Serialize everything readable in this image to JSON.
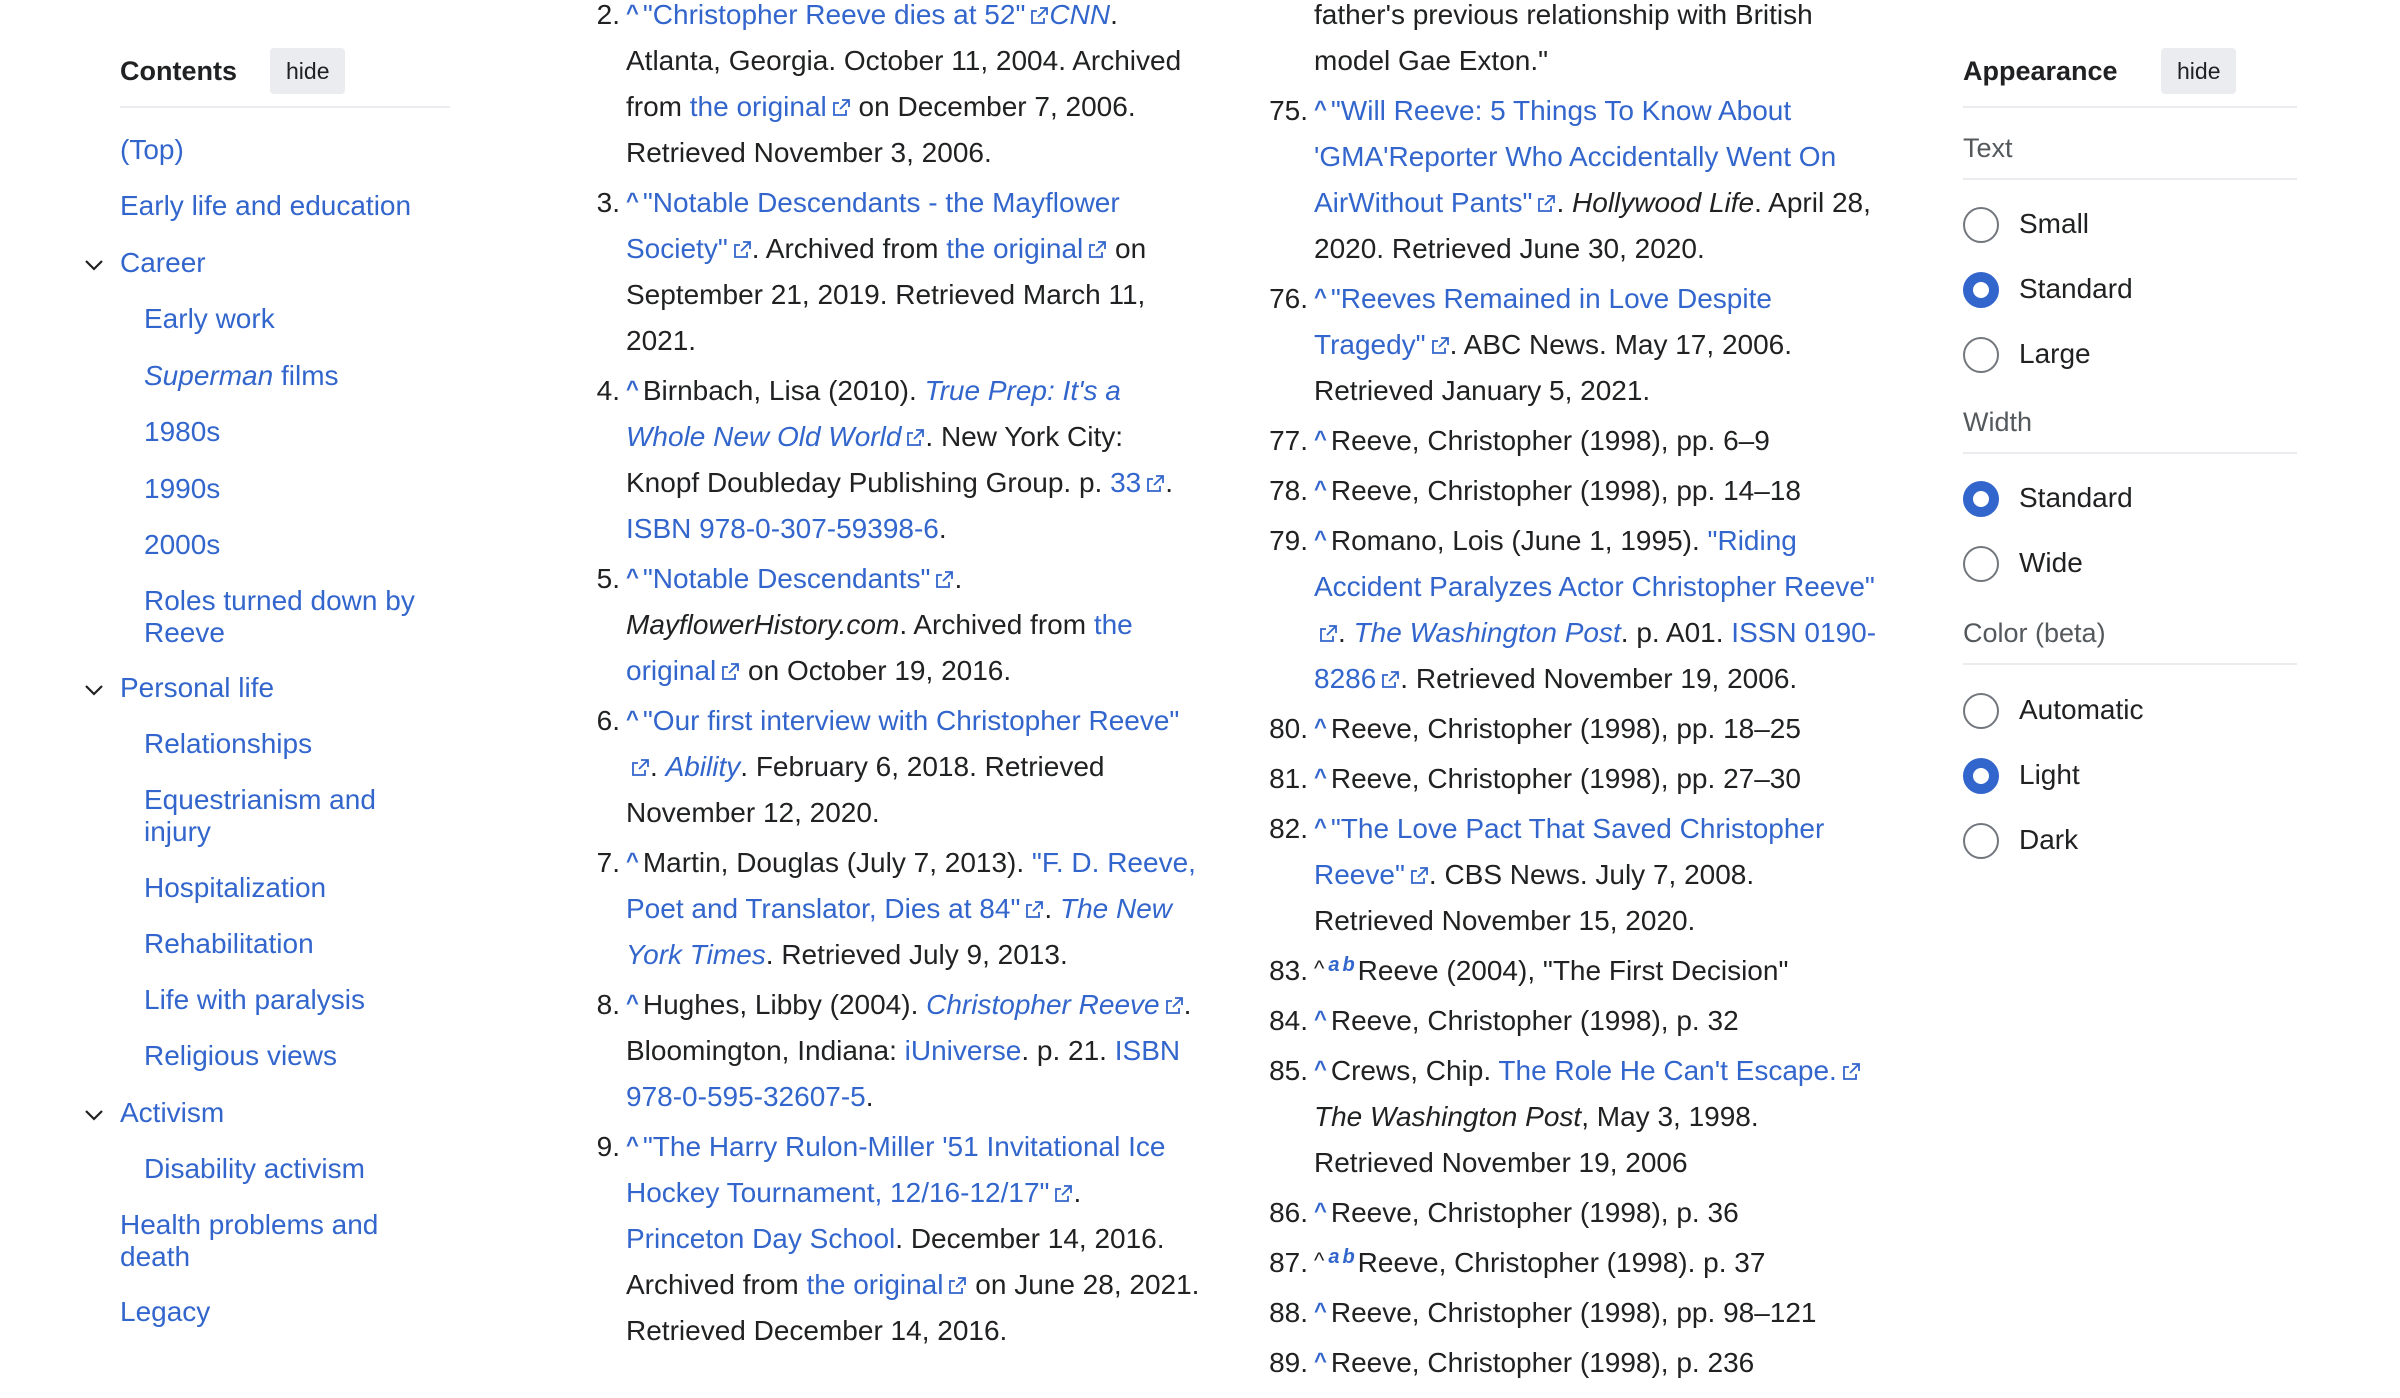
{
  "toc": {
    "title": "Contents",
    "hide_label": "hide",
    "items": [
      {
        "label": "(Top)"
      },
      {
        "label": "Early life and education"
      },
      {
        "label": "Career"
      },
      {
        "label": "Early work"
      },
      {
        "label": "Superman",
        "label_rest": " films"
      },
      {
        "label": "1980s"
      },
      {
        "label": "1990s"
      },
      {
        "label": "2000s"
      },
      {
        "label": "Roles turned down by Reeve"
      },
      {
        "label": "Personal life"
      },
      {
        "label": "Relationships"
      },
      {
        "label": "Equestrianism and injury"
      },
      {
        "label": "Hospitalization"
      },
      {
        "label": "Rehabilitation"
      },
      {
        "label": "Life with paralysis"
      },
      {
        "label": "Religious views"
      },
      {
        "label": "Activism"
      },
      {
        "label": "Disability activism"
      },
      {
        "label": "Health problems and death"
      },
      {
        "label": "Legacy"
      }
    ]
  },
  "refs_left": [
    {
      "num": "2.",
      "parts": [
        "\"Christopher Reeve dies at 52\"",
        "CNN",
        ". Atlanta, Georgia. October 11, 2004. Archived from ",
        "the original",
        " on December 7, 2006. Retrieved November 3, 2006."
      ]
    },
    {
      "num": "3.",
      "parts": [
        "\"Notable Descendants - the Mayflower Society\"",
        ". Archived from ",
        "the original",
        " on September 21, 2019. Retrieved March 11, 2021."
      ]
    },
    {
      "num": "4.",
      "parts": [
        "Birnbach, Lisa (2010). ",
        "True Prep: It's a Whole New Old World",
        ". New York City: Knopf Doubleday Publishing Group. p. ",
        "33",
        ". ",
        "ISBN 978-0-307-59398-6",
        "."
      ]
    },
    {
      "num": "5.",
      "parts": [
        "\"Notable Descendants\"",
        ". ",
        "MayflowerHistory.com",
        ". Archived from ",
        "the original",
        " on October 19, 2016."
      ]
    },
    {
      "num": "6.",
      "parts": [
        "\"Our first interview with Christopher Reeve\"",
        ". ",
        "Ability",
        ". February 6, 2018. Retrieved November 12, 2020."
      ]
    },
    {
      "num": "7.",
      "parts": [
        "Martin, Douglas (July 7, 2013). ",
        "\"F. D. Reeve, Poet and Translator, Dies at 84\"",
        ". ",
        "The New York Times",
        ". Retrieved July 9, 2013."
      ]
    },
    {
      "num": "8.",
      "parts": [
        "Hughes, Libby (2004). ",
        "Christopher Reeve",
        ". Bloomington, Indiana: ",
        "iUniverse",
        ". p. 21. ",
        "ISBN 978-0-595-32607-5",
        "."
      ]
    },
    {
      "num": "9.",
      "parts": [
        "\"The Harry Rulon-Miller '51 Invitational Ice Hockey Tournament, 12/16-12/17\"",
        ". ",
        "Princeton Day School",
        ". December 14, 2016. Archived from ",
        "the original",
        " on June 28, 2021. Retrieved December 14, 2016."
      ]
    }
  ],
  "refs_right": [
    {
      "num": "",
      "parts": [
        "father's previous relationship with British model Gae Exton.\""
      ]
    },
    {
      "num": "75.",
      "parts": [
        "\"Will Reeve: 5 Things To Know About 'GMA'Reporter Who Accidentally Went On AirWithout Pants\"",
        ". ",
        "Hollywood Life",
        ". April 28, 2020. Retrieved June 30, 2020."
      ]
    },
    {
      "num": "76.",
      "parts": [
        "\"Reeves Remained in Love Despite Tragedy\"",
        ". ABC News. May 17, 2006. Retrieved January 5, 2021."
      ]
    },
    {
      "num": "77.",
      "parts": [
        "Reeve, Christopher (1998), pp. 6–9"
      ]
    },
    {
      "num": "78.",
      "parts": [
        "Reeve, Christopher (1998), pp. 14–18"
      ]
    },
    {
      "num": "79.",
      "parts": [
        "Romano, Lois (June 1, 1995). ",
        "\"Riding Accident Paralyzes Actor Christopher Reeve\"",
        ". ",
        "The Washington Post",
        ". p. A01. ",
        "ISSN 0190-8286",
        ". Retrieved November 19, 2006."
      ]
    },
    {
      "num": "80.",
      "parts": [
        "Reeve, Christopher (1998), pp. 18–25"
      ]
    },
    {
      "num": "81.",
      "parts": [
        "Reeve, Christopher (1998), pp. 27–30"
      ]
    },
    {
      "num": "82.",
      "parts": [
        "\"The Love Pact That Saved Christopher Reeve\"",
        ". CBS News. July 7, 2008. Retrieved November 15, 2020."
      ]
    },
    {
      "num": "83.",
      "sup_a": "a",
      "sup_b": "b",
      "parts": [
        "Reeve (2004), \"The First Decision\""
      ]
    },
    {
      "num": "84.",
      "parts": [
        "Reeve, Christopher (1998), p. 32"
      ]
    },
    {
      "num": "85.",
      "parts": [
        "Crews, Chip. ",
        "The Role He Can't Escape.",
        " ",
        "The Washington Post",
        ", May 3, 1998. Retrieved November 19, 2006"
      ]
    },
    {
      "num": "86.",
      "parts": [
        "Reeve, Christopher (1998), p. 36"
      ]
    },
    {
      "num": "87.",
      "sup_a": "a",
      "sup_b": "b",
      "parts": [
        "Reeve, Christopher (1998). p. 37"
      ]
    },
    {
      "num": "88.",
      "parts": [
        "Reeve, Christopher (1998), pp. 98–121"
      ]
    },
    {
      "num": "89.",
      "parts": [
        "Reeve, Christopher (1998), p. 236"
      ]
    }
  ],
  "caret": "^",
  "appearance": {
    "title": "Appearance",
    "hide_label": "hide",
    "text_label": "Text",
    "text_options": [
      "Small",
      "Standard",
      "Large"
    ],
    "text_selected": "Standard",
    "width_label": "Width",
    "width_options": [
      "Standard",
      "Wide"
    ],
    "width_selected": "Standard",
    "color_label": "Color (beta)",
    "color_options": [
      "Automatic",
      "Light",
      "Dark"
    ],
    "color_selected": "Light"
  },
  "colors": {
    "link": "#3366cc",
    "text": "#202122",
    "radio_on": "#3366cc"
  }
}
